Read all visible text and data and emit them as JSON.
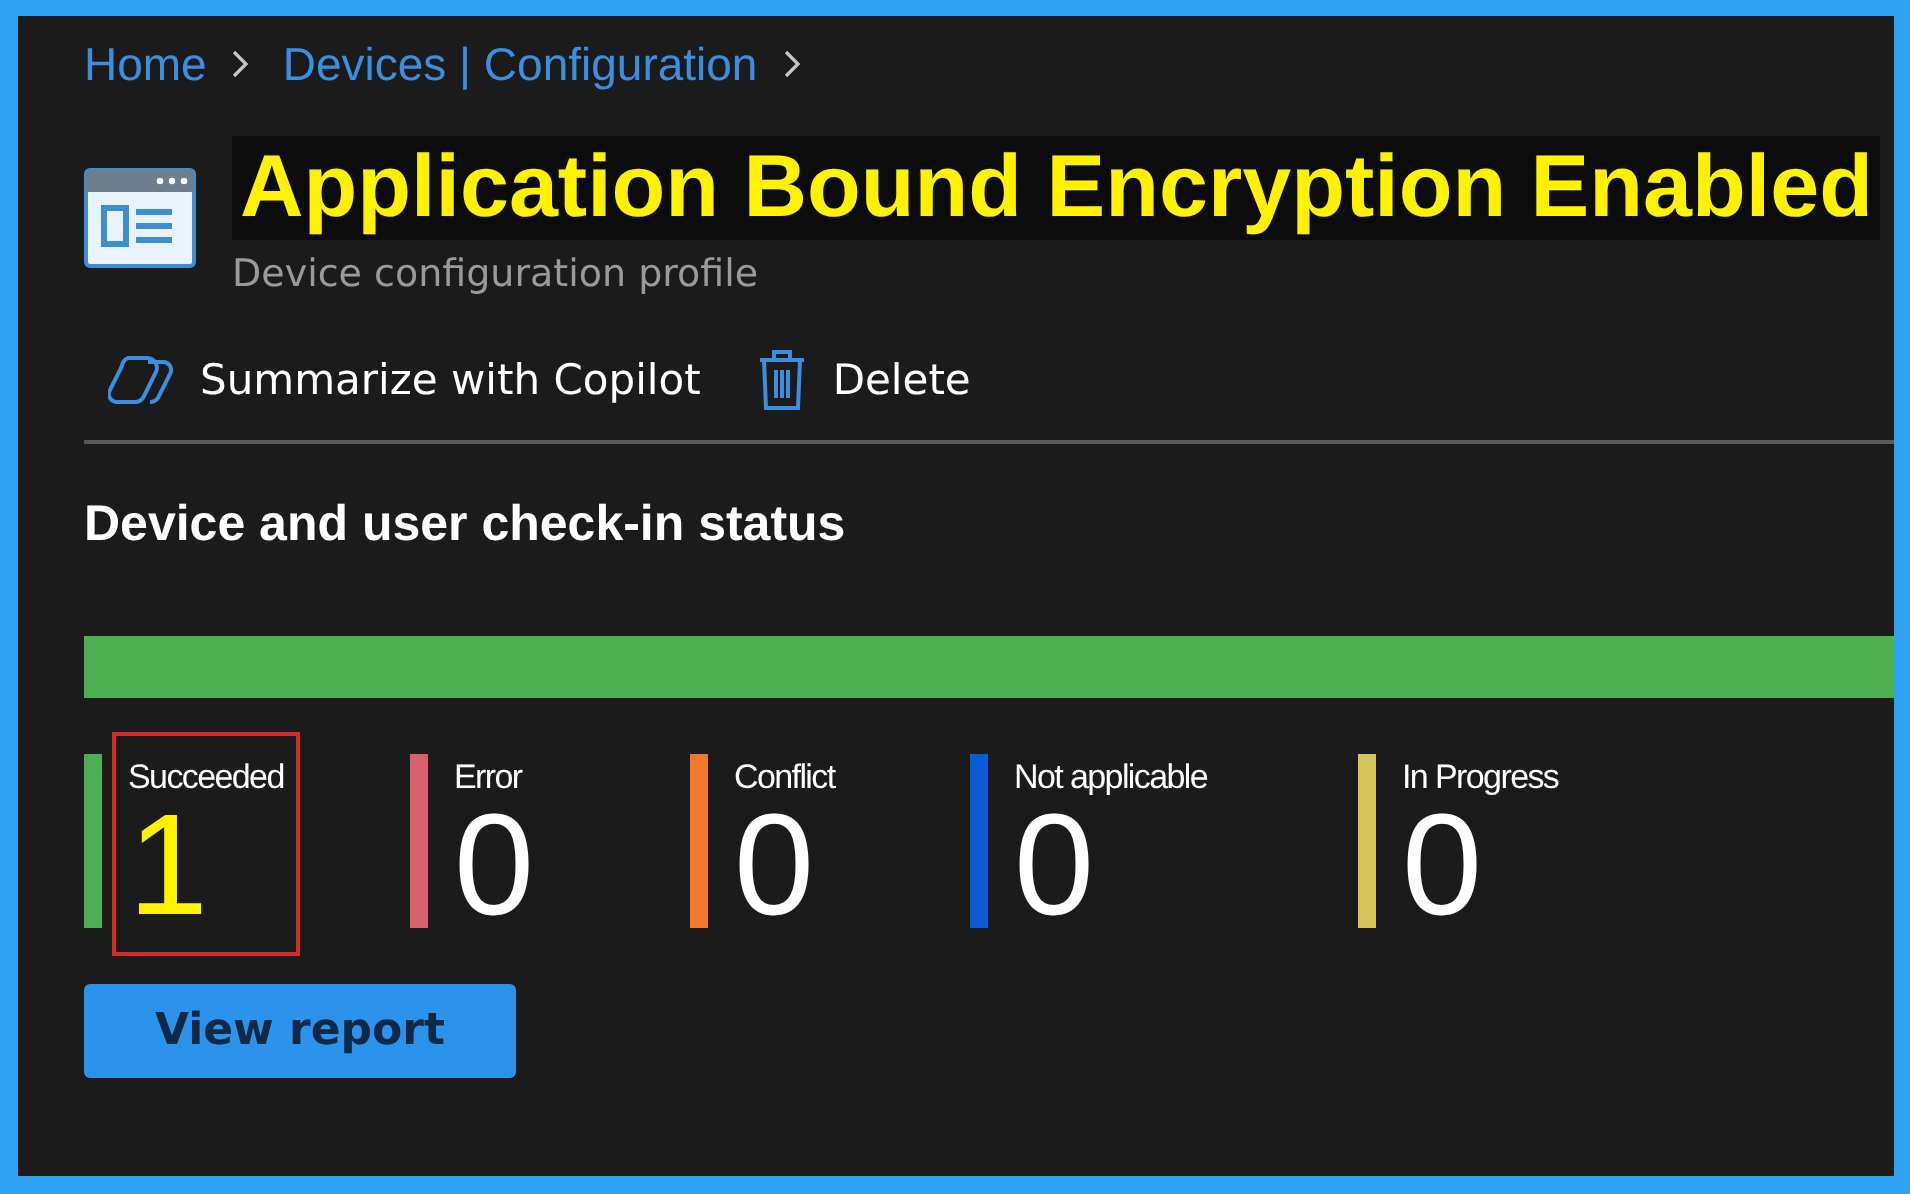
{
  "breadcrumb": [
    "Home",
    "Devices | Configuration"
  ],
  "header": {
    "title": "Application Bound Encryption Enabled",
    "subtitle": "Device configuration profile"
  },
  "toolbar": [
    {
      "kind": "copilot",
      "label": "Summarize with Copilot"
    },
    {
      "kind": "delete",
      "label": "Delete"
    }
  ],
  "section": {
    "title": "Device and user check-in status"
  },
  "status_bar": {
    "color": "#4caf50",
    "level": 1
  },
  "tiles": [
    {
      "label": "Succeeded",
      "value": "1",
      "color": "#4caf50",
      "highlighted": true
    },
    {
      "label": "Error",
      "value": "0",
      "color": "#d9606e",
      "highlighted": false
    },
    {
      "label": "Conflict",
      "value": "0",
      "color": "#f47a2a",
      "highlighted": false
    },
    {
      "label": "Not applicable",
      "value": "0",
      "color": "#0a5bd6",
      "highlighted": false
    },
    {
      "label": "In Progress",
      "value": "0",
      "color": "#d8c25a",
      "highlighted": false
    }
  ],
  "button": {
    "label": "View report"
  }
}
